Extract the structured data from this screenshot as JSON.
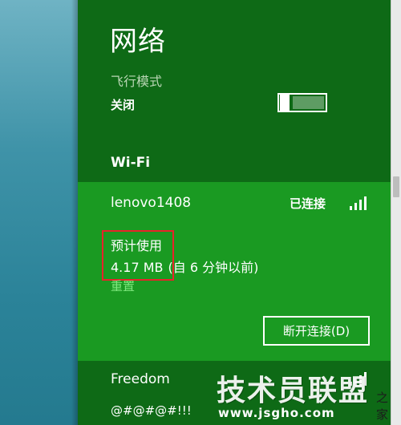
{
  "panel": {
    "title": "网络"
  },
  "airplane_mode": {
    "label": "飞行模式",
    "state": "关闭"
  },
  "wifi": {
    "heading": "Wi-Fi",
    "connected_network": {
      "name": "lenovo1408",
      "status": "已连接",
      "usage_label": "预计使用",
      "usage_value": "4.17 MB",
      "usage_note": "(自 6 分钟以前)",
      "reset_label": "重置",
      "disconnect_label": "断开连接(D)"
    },
    "other_networks": [
      {
        "name": "Freedom"
      },
      {
        "name": "@#@#@#!!!"
      }
    ]
  },
  "watermark": {
    "main": "技术员联盟",
    "suffix": "之家",
    "url": "www.jsgho.com"
  },
  "colors": {
    "panel_bg": "#0e6a16",
    "selected_bg": "#1a9a22",
    "highlight_box": "#e8232a",
    "link": "#7fe87f"
  }
}
